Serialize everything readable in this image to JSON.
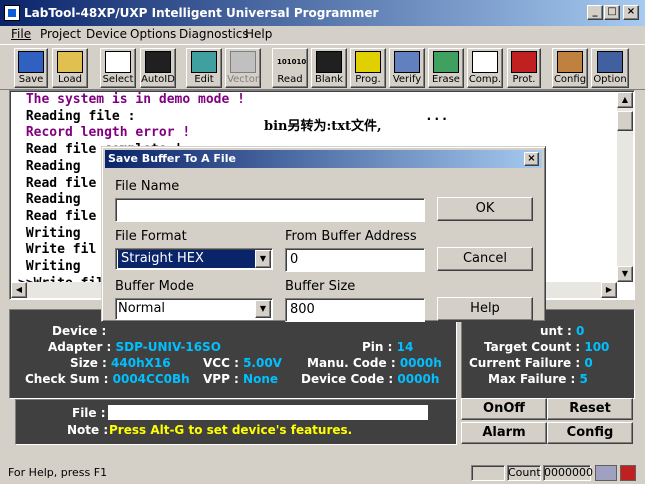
{
  "window": {
    "title": "LabTool-48XP/UXP Intelligent Universal Programmer"
  },
  "menu": [
    "File",
    "Project",
    "Device",
    "Options",
    "Diagnostics",
    "Help"
  ],
  "toolbar": [
    {
      "label": "Save",
      "icon": "save-icon"
    },
    {
      "label": "Load",
      "icon": "load-icon"
    },
    {
      "label": "Select",
      "icon": "select-icon"
    },
    {
      "label": "AutoID",
      "icon": "autoid-icon"
    },
    {
      "label": "Edit",
      "icon": "edit-icon"
    },
    {
      "label": "Vector",
      "icon": "vector-icon",
      "disabled": true
    },
    {
      "label": "Read",
      "icon": "read-icon",
      "icon_text": "101010"
    },
    {
      "label": "Blank",
      "icon": "blank-icon"
    },
    {
      "label": "Prog.",
      "icon": "program-icon"
    },
    {
      "label": "Verify",
      "icon": "verify-icon"
    },
    {
      "label": "Erase",
      "icon": "erase-icon"
    },
    {
      "label": "Comp.",
      "icon": "compare-icon"
    },
    {
      "label": "Prot.",
      "icon": "protect-icon"
    },
    {
      "label": "Config",
      "icon": "config-icon"
    },
    {
      "label": "Option",
      "icon": "option-icon"
    }
  ],
  "log": {
    "lines": [
      {
        "text": " The system is in demo mode !",
        "color": "#800080"
      },
      {
        "text": " Reading file :                                     ...",
        "color": "#000000"
      },
      {
        "text": " Record length error !",
        "color": "#800080"
      },
      {
        "text": " Read file complete !",
        "color": "#000000"
      },
      {
        "text": " Reading                                      ...",
        "color": "#000000"
      },
      {
        "text": " Read file                                    ...",
        "color": "#000000"
      },
      {
        "text": " Reading                                      ...",
        "color": "#000000"
      },
      {
        "text": " Read file                                    ...",
        "color": "#000000"
      },
      {
        "text": " Writing                                      ...",
        "color": "#000000"
      },
      {
        "text": " Write fil                                    ...",
        "color": "#000000"
      },
      {
        "text": " Writing                                      ...",
        "color": "#000000"
      },
      {
        "text": ">>Write fil",
        "color": "#000000"
      }
    ]
  },
  "annotation": "bin另转为:txt文件,",
  "device_info": {
    "device_label": "Device :",
    "adapter_label": "Adapter :",
    "adapter_value": "SDP-UNIV-16SO",
    "pin_label": "Pin :",
    "pin_value": "14",
    "size_label": "Size :",
    "size_value": "440hX16",
    "vcc_label": "VCC :",
    "vcc_value": "5.00V",
    "manu_label": "Manu. Code :",
    "manu_value": "0000h",
    "checksum_label": "Check Sum :",
    "checksum_value": "0004CC0Bh",
    "vpp_label": "VPP :",
    "vpp_value": "None",
    "devcode_label": "Device Code :",
    "devcode_value": "0000h"
  },
  "stats": {
    "count_label": "unt :",
    "count_value": "0",
    "target_label": "Target Count :",
    "target_value": "100",
    "current_label": "Current Failure :",
    "current_value": "0",
    "max_label": "Max Failure :",
    "max_value": "5"
  },
  "file_panel": {
    "file_label": "File :",
    "note_label": "Note :",
    "note_text": "Press Alt-G to set device's features."
  },
  "panel_buttons": {
    "onoff": "OnOff",
    "reset": "Reset",
    "alarm": "Alarm",
    "config": "Config"
  },
  "statusbar": {
    "help": "For Help, press F1",
    "count_label": "Count",
    "count_value": "0000000"
  },
  "dialog": {
    "title": "Save Buffer To A File",
    "file_name_label": "File Name",
    "file_name_value": "",
    "file_format_label": "File Format",
    "file_format_value": "Straight HEX",
    "from_addr_label": "From Buffer Address",
    "from_addr_value": "0",
    "buffer_mode_label": "Buffer Mode",
    "buffer_mode_value": "Normal",
    "buffer_size_label": "Buffer Size",
    "buffer_size_value": "800",
    "ok": "OK",
    "cancel": "Cancel",
    "help": "Help"
  }
}
